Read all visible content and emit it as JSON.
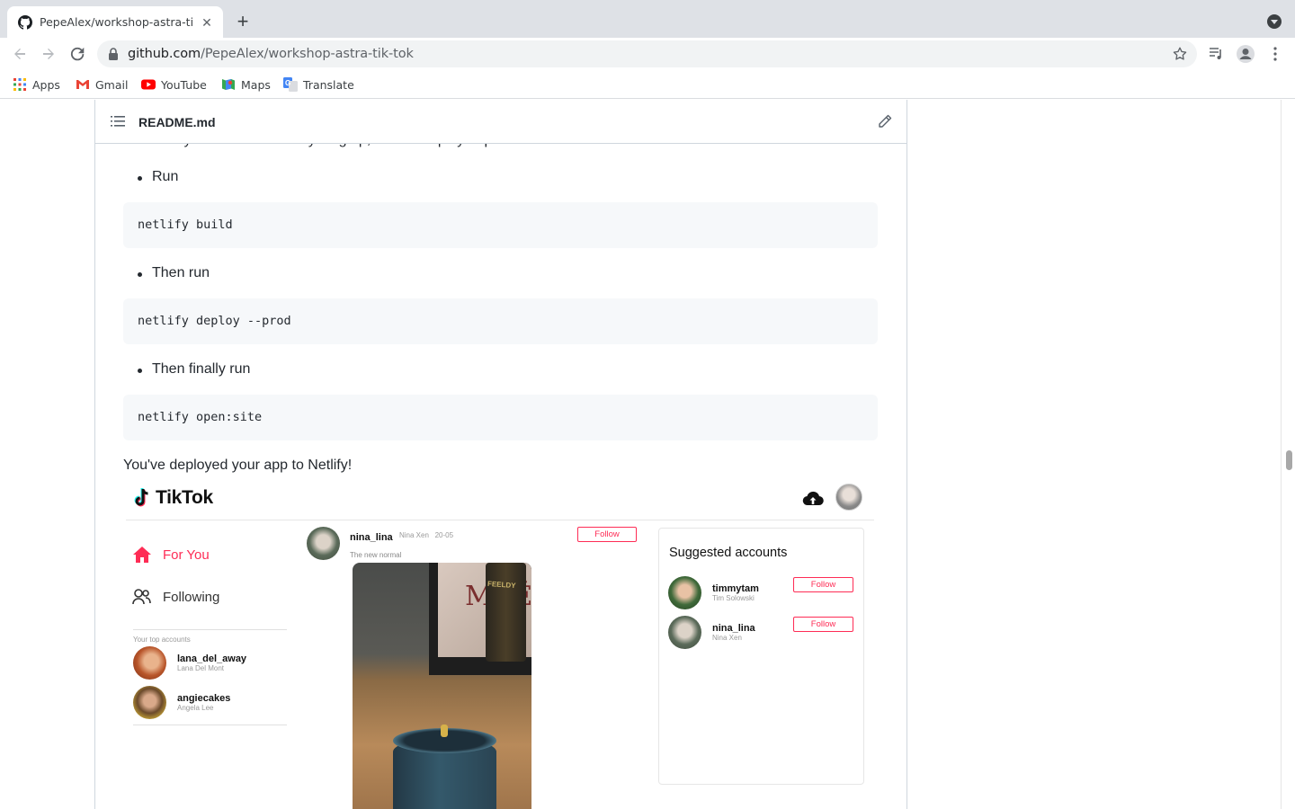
{
  "browser": {
    "tab_title": "PepeAlex/workshop-astra-tik-t",
    "tab_close": "✕",
    "new_tab": "+",
    "url_host": "github.com",
    "url_path": "/PepeAlex/workshop-astra-tik-tok",
    "bookmarks": [
      {
        "label": "Apps",
        "icon": "apps-grid-icon"
      },
      {
        "label": "Gmail",
        "icon": "gmail-icon"
      },
      {
        "label": "YouTube",
        "icon": "youtube-icon"
      },
      {
        "label": "Maps",
        "icon": "maps-icon"
      },
      {
        "label": "Translate",
        "icon": "translate-icon"
      }
    ]
  },
  "readme": {
    "filename": "README.md",
    "clipped_text": "Now that you've hooked everything up, time to deploy to production!",
    "items": [
      {
        "bullet": "Run",
        "code": "netlify build"
      },
      {
        "bullet": "Then run",
        "code": "netlify deploy --prod"
      },
      {
        "bullet": "Then finally run",
        "code": "netlify open:site"
      }
    ],
    "closing": "You've deployed your app to Netlify!"
  },
  "tiktok": {
    "logo": "TikTok",
    "nav": [
      {
        "label": "For You",
        "active": true
      },
      {
        "label": "Following",
        "active": false
      }
    ],
    "top_accounts_label": "Your top accounts",
    "top_accounts": [
      {
        "username": "lana_del_away",
        "name": "Lana Del Mont"
      },
      {
        "username": "angiecakes",
        "name": "Angela Lee"
      }
    ],
    "post": {
      "username": "nina_lina",
      "name": "Nina Xen",
      "date": "20-05",
      "caption": "The new normal",
      "follow": "Follow",
      "frame_text": "MOË",
      "bottle_text": "FEELDY"
    },
    "suggested_title": "Suggested accounts",
    "suggested": [
      {
        "username": "timmytam",
        "name": "Tim Solowski",
        "follow": "Follow"
      },
      {
        "username": "nina_lina",
        "name": "Nina Xen",
        "follow": "Follow"
      }
    ],
    "accent": "#fe2c55"
  }
}
